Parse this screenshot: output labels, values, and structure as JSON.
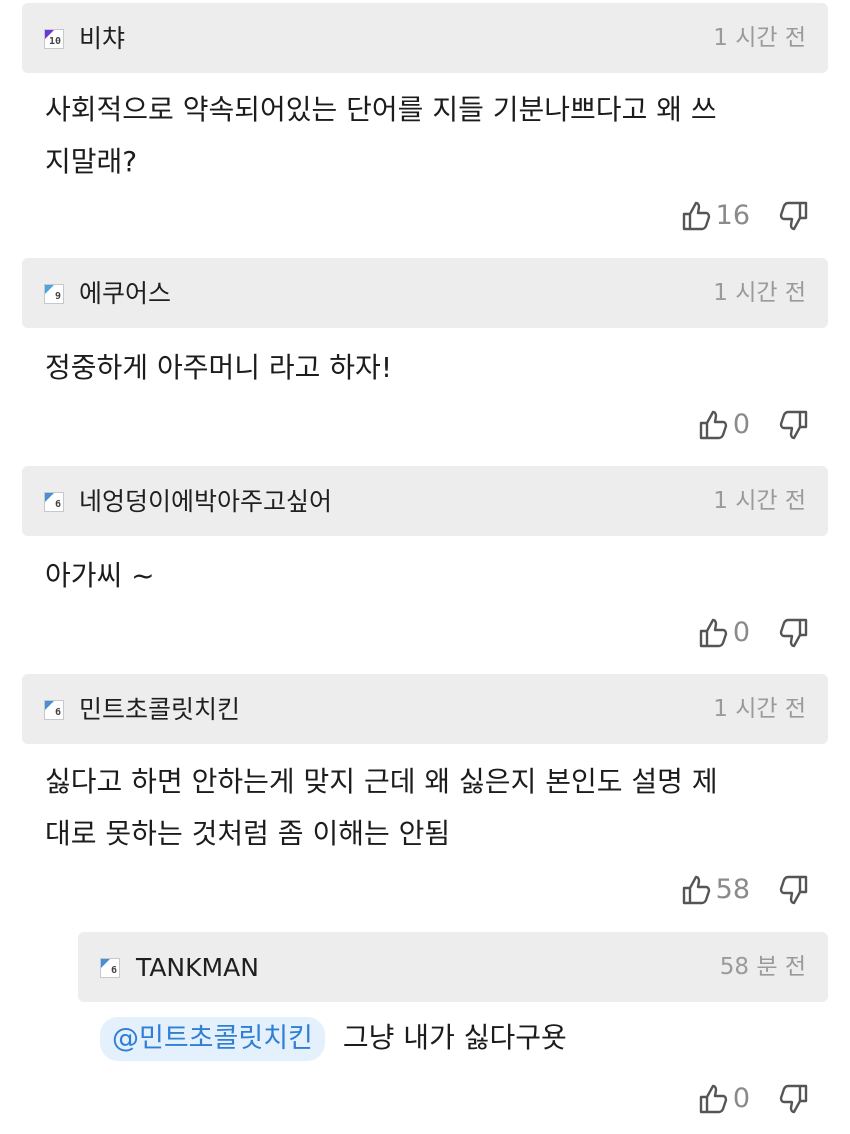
{
  "comments": [
    {
      "level": "10",
      "nickname": "비챠",
      "time": "1 시간 전",
      "text_lines": [
        "사회적으로 약속되어있는 단어를 지들 기분나쁘다고 왜 쓰",
        "지말래?"
      ],
      "likes": "16"
    },
    {
      "level": "9",
      "nickname": "에쿠어스",
      "time": "1 시간 전",
      "text_lines": [
        "정중하게 아주머니 라고 하자!"
      ],
      "likes": "0"
    },
    {
      "level": "6",
      "nickname": "네엉덩이에박아주고싶어",
      "time": "1 시간 전",
      "text_lines": [
        "아가씨 ~"
      ],
      "likes": "0"
    },
    {
      "level": "6",
      "nickname": "민트초콜릿치킨",
      "time": "1 시간 전",
      "text_lines": [
        "싫다고 하면 안하는게 맞지 근데 왜 싫은지 본인도 설명 제",
        "대로 못하는 것처럼 좀 이해는 안됨"
      ],
      "likes": "58"
    }
  ],
  "reply": {
    "level": "6",
    "nickname": "TANKMAN",
    "time": "58 분 전",
    "mention": "@민트초콜릿치킨",
    "text": "그냥 내가 싫다구욧",
    "likes": "0"
  },
  "icons": {
    "like": "thumbs-up-icon",
    "dislike": "thumbs-down-icon",
    "level": "level-badge-icon"
  },
  "colors": {
    "header_bg": "#ededee",
    "mention_bg": "#e4f0fb",
    "mention_text": "#2f7fd6",
    "muted_text": "#9a9a9a"
  }
}
